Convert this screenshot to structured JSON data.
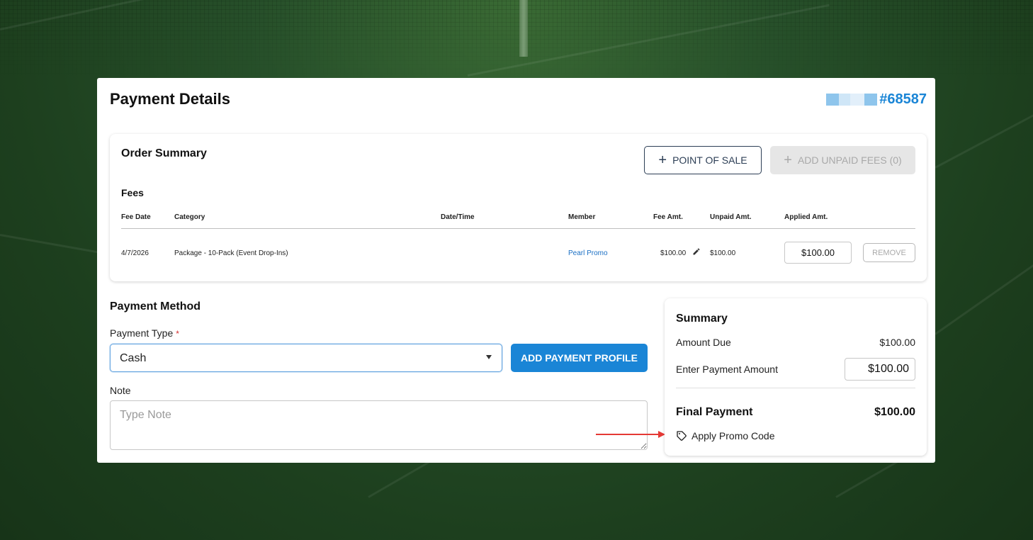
{
  "page": {
    "title": "Payment Details",
    "order_number": "#68587"
  },
  "order_summary": {
    "title": "Order Summary",
    "point_of_sale_label": "POINT OF SALE",
    "add_unpaid_fees_label": "ADD UNPAID FEES (0)",
    "fees_title": "Fees",
    "columns": [
      "Fee Date",
      "Category",
      "Date/Time",
      "Member",
      "Fee Amt.",
      "Unpaid Amt.",
      "Applied Amt."
    ],
    "rows": [
      {
        "fee_date": "4/7/2026",
        "category": "Package - 10-Pack (Event Drop-Ins)",
        "date_time": "",
        "member": "Pearl Promo",
        "fee_amt": "$100.00",
        "unpaid_amt": "$100.00",
        "applied_amt": "$100.00",
        "remove_label": "REMOVE"
      }
    ]
  },
  "payment_method": {
    "title": "Payment Method",
    "payment_type_label": "Payment Type",
    "required_marker": "*",
    "payment_type_value": "Cash",
    "add_payment_profile_label": "ADD PAYMENT PROFILE",
    "note_label": "Note",
    "note_placeholder": "Type Note"
  },
  "summary": {
    "title": "Summary",
    "amount_due_label": "Amount Due",
    "amount_due_value": "$100.00",
    "enter_payment_label": "Enter Payment Amount",
    "enter_payment_value": "$100.00",
    "final_payment_label": "Final Payment",
    "final_payment_value": "$100.00",
    "promo_label": "Apply Promo Code"
  },
  "colors": {
    "accent": "#1a85d6",
    "link": "#1a6fc4",
    "annotation_arrow": "#e53935",
    "background": "#27502a"
  },
  "icons": [
    "plus-icon",
    "pencil-icon",
    "caret-down-icon",
    "tag-icon",
    "arrow-right-icon"
  ]
}
